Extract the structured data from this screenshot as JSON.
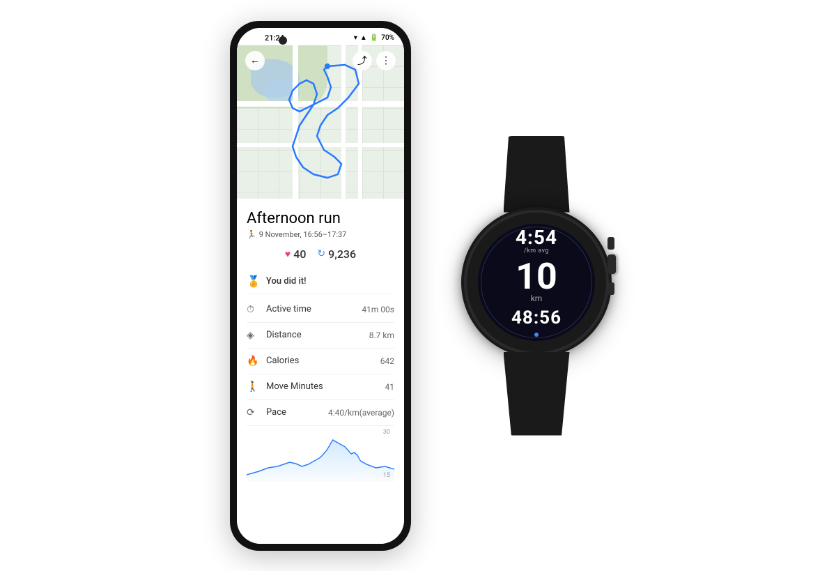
{
  "phone": {
    "status": {
      "time": "21:24",
      "battery": "70%",
      "signal": "▲▲▲",
      "wifi": "▼"
    },
    "activity": {
      "title": "Afternoon run",
      "subtitle_icon": "🚶",
      "subtitle": "9 November, 16:56–17:37",
      "heart_count": "40",
      "steps_count": "9,236",
      "achievement": "You did it!"
    },
    "metrics": [
      {
        "icon": "⏱",
        "label": "Active time",
        "value": "41m 00s"
      },
      {
        "icon": "◈",
        "label": "Distance",
        "value": "8.7 km"
      },
      {
        "icon": "🔥",
        "label": "Calories",
        "value": "642"
      },
      {
        "icon": "🚶",
        "label": "Move Minutes",
        "value": "41"
      },
      {
        "icon": "⟳",
        "label": "Pace",
        "value": "4:40/km(average)"
      }
    ],
    "chart": {
      "top_label": "30",
      "bottom_label": "15"
    }
  },
  "watch": {
    "pace": "4:54",
    "pace_label": "/km avg",
    "distance": "10",
    "distance_unit": "km",
    "time": "48:56"
  }
}
